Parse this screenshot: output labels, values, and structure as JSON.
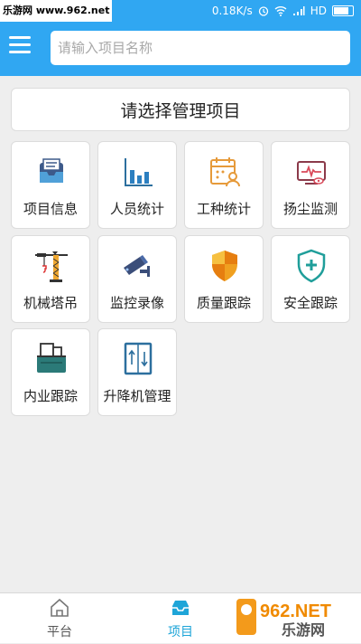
{
  "status_bar": {
    "watermark": "乐游网 www.962.net",
    "speed": "0.18K/s",
    "network": "HD"
  },
  "header": {
    "search_placeholder": "请输入项目名称"
  },
  "project_select": {
    "label": "请选择管理项目"
  },
  "tiles": [
    {
      "label": "项目信息",
      "icon": "inbox-icon"
    },
    {
      "label": "人员统计",
      "icon": "bar-chart-icon"
    },
    {
      "label": "工种统计",
      "icon": "calendar-person-icon"
    },
    {
      "label": "扬尘监测",
      "icon": "monitor-pulse-icon"
    },
    {
      "label": "机械塔吊",
      "icon": "tower-crane-icon"
    },
    {
      "label": "监控录像",
      "icon": "cctv-camera-icon"
    },
    {
      "label": "质量跟踪",
      "icon": "quality-shield-icon"
    },
    {
      "label": "安全跟踪",
      "icon": "safety-shield-icon"
    },
    {
      "label": "内业跟踪",
      "icon": "box-tracking-icon"
    },
    {
      "label": "升降机管理",
      "icon": "elevator-icon"
    }
  ],
  "bottom_nav": {
    "platform_label": "平台",
    "project_label": "项目",
    "active_color": "#1ea5d8"
  },
  "watermark_logo": {
    "text_top": "962.NET",
    "text_bottom": "乐游网"
  },
  "colors": {
    "accent": "#30a7f2",
    "background": "#eeeeee"
  }
}
